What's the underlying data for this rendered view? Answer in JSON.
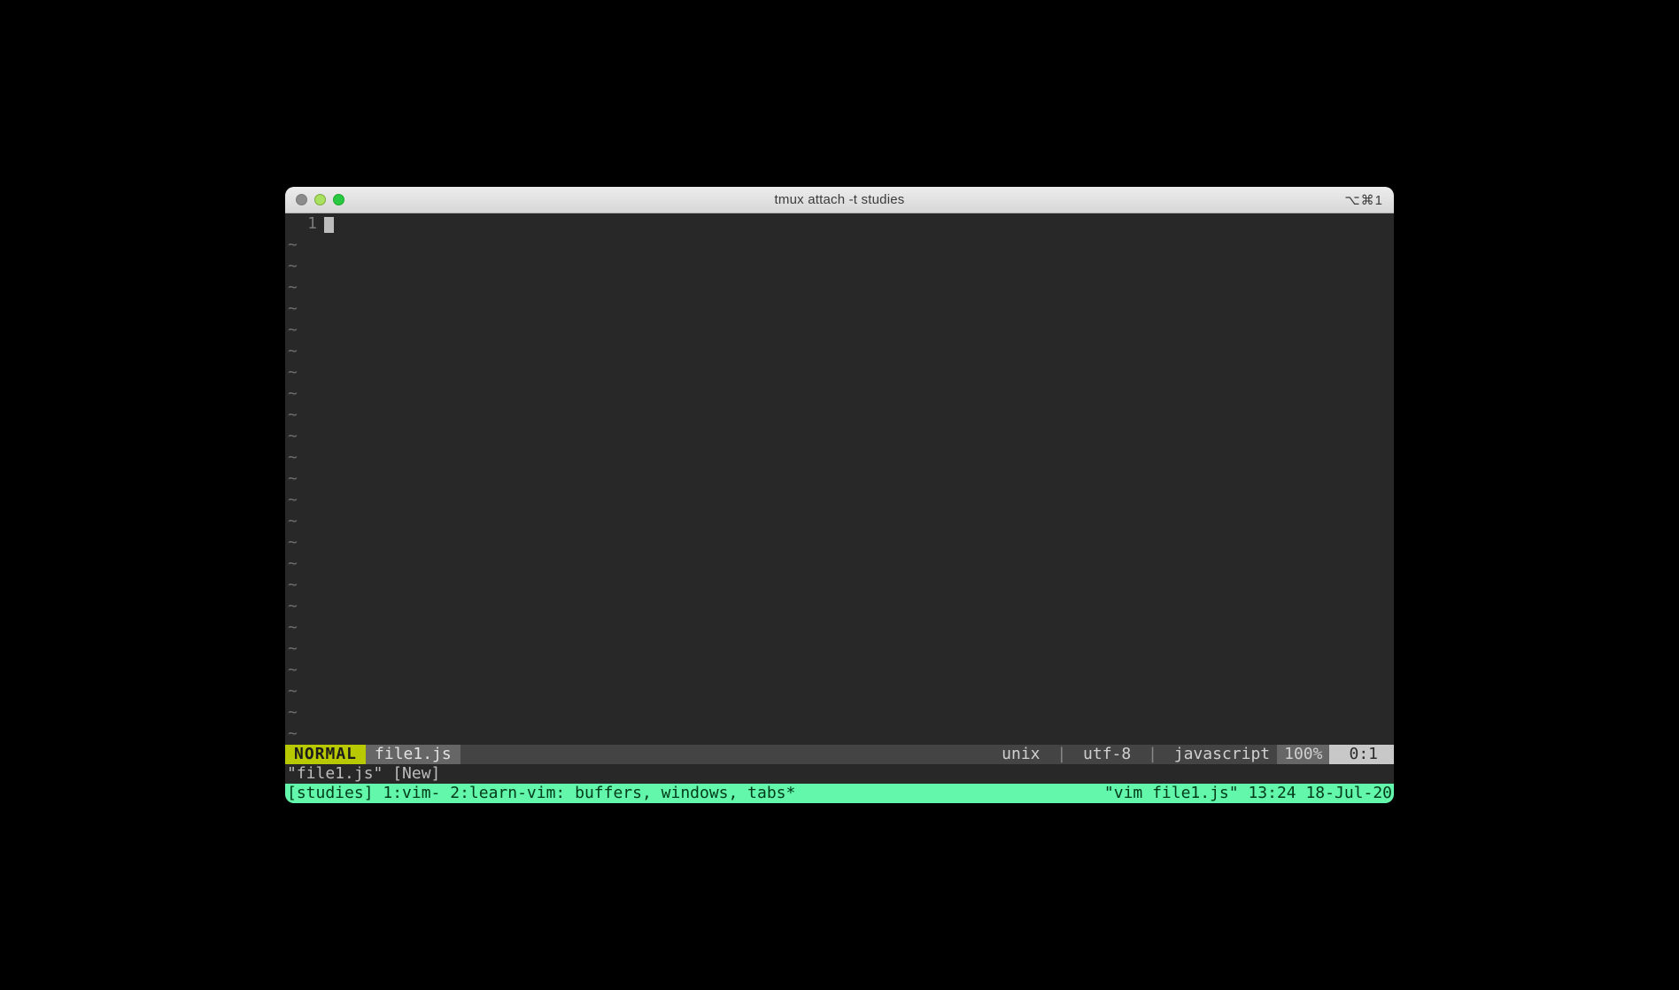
{
  "titlebar": {
    "title": "tmux attach -t studies",
    "shortcut": "⌥⌘1"
  },
  "editor": {
    "line_number": "1",
    "tilde": "~",
    "tilde_rows": 24
  },
  "statusline": {
    "mode": "NORMAL",
    "filename": "file1.js",
    "fileformat": "unix",
    "encoding": "utf-8",
    "filetype": "javascript",
    "percent": "100%",
    "linecol": "0:1",
    "sep": "|"
  },
  "message": "\"file1.js\" [New]",
  "tmux": {
    "left": "[studies] 1:vim- 2:learn-vim: buffers, windows, tabs*",
    "right": "\"vim file1.js\" 13:24 18-Jul-20"
  }
}
